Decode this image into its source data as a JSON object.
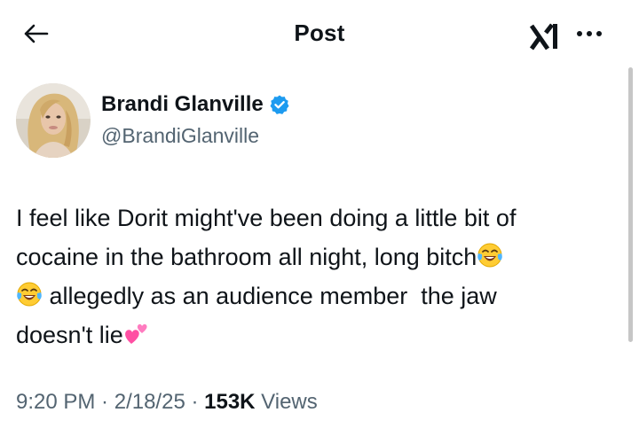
{
  "header": {
    "title": "Post"
  },
  "author": {
    "name": "Brandi Glanville",
    "handle": "@BrandiGlanville"
  },
  "tweet": {
    "line1": "I feel like Dorit might've been doing a little bit of",
    "line2": "cocaine in the bathroom all night, long bitch",
    "line3": " allegedly as an audience member  the jaw",
    "line4": "doesn't lie"
  },
  "meta": {
    "time": "9:20 PM",
    "separator1": " · ",
    "date": "2/18/25",
    "separator2": " · ",
    "views_count": "153K",
    "views_label": " Views"
  },
  "icons": {
    "back": "arrow-left-icon",
    "grok": "grok-icon",
    "more": "more-dots-icon",
    "verified": "verified-badge-icon",
    "laugh_emoji": "face-with-tears-of-joy-emoji",
    "hearts_emoji": "two-hearts-emoji"
  },
  "colors": {
    "text_primary": "#0f1419",
    "text_secondary": "#536471",
    "verified_blue": "#1d9bf0",
    "heart_pink": "#ff4fa3"
  }
}
